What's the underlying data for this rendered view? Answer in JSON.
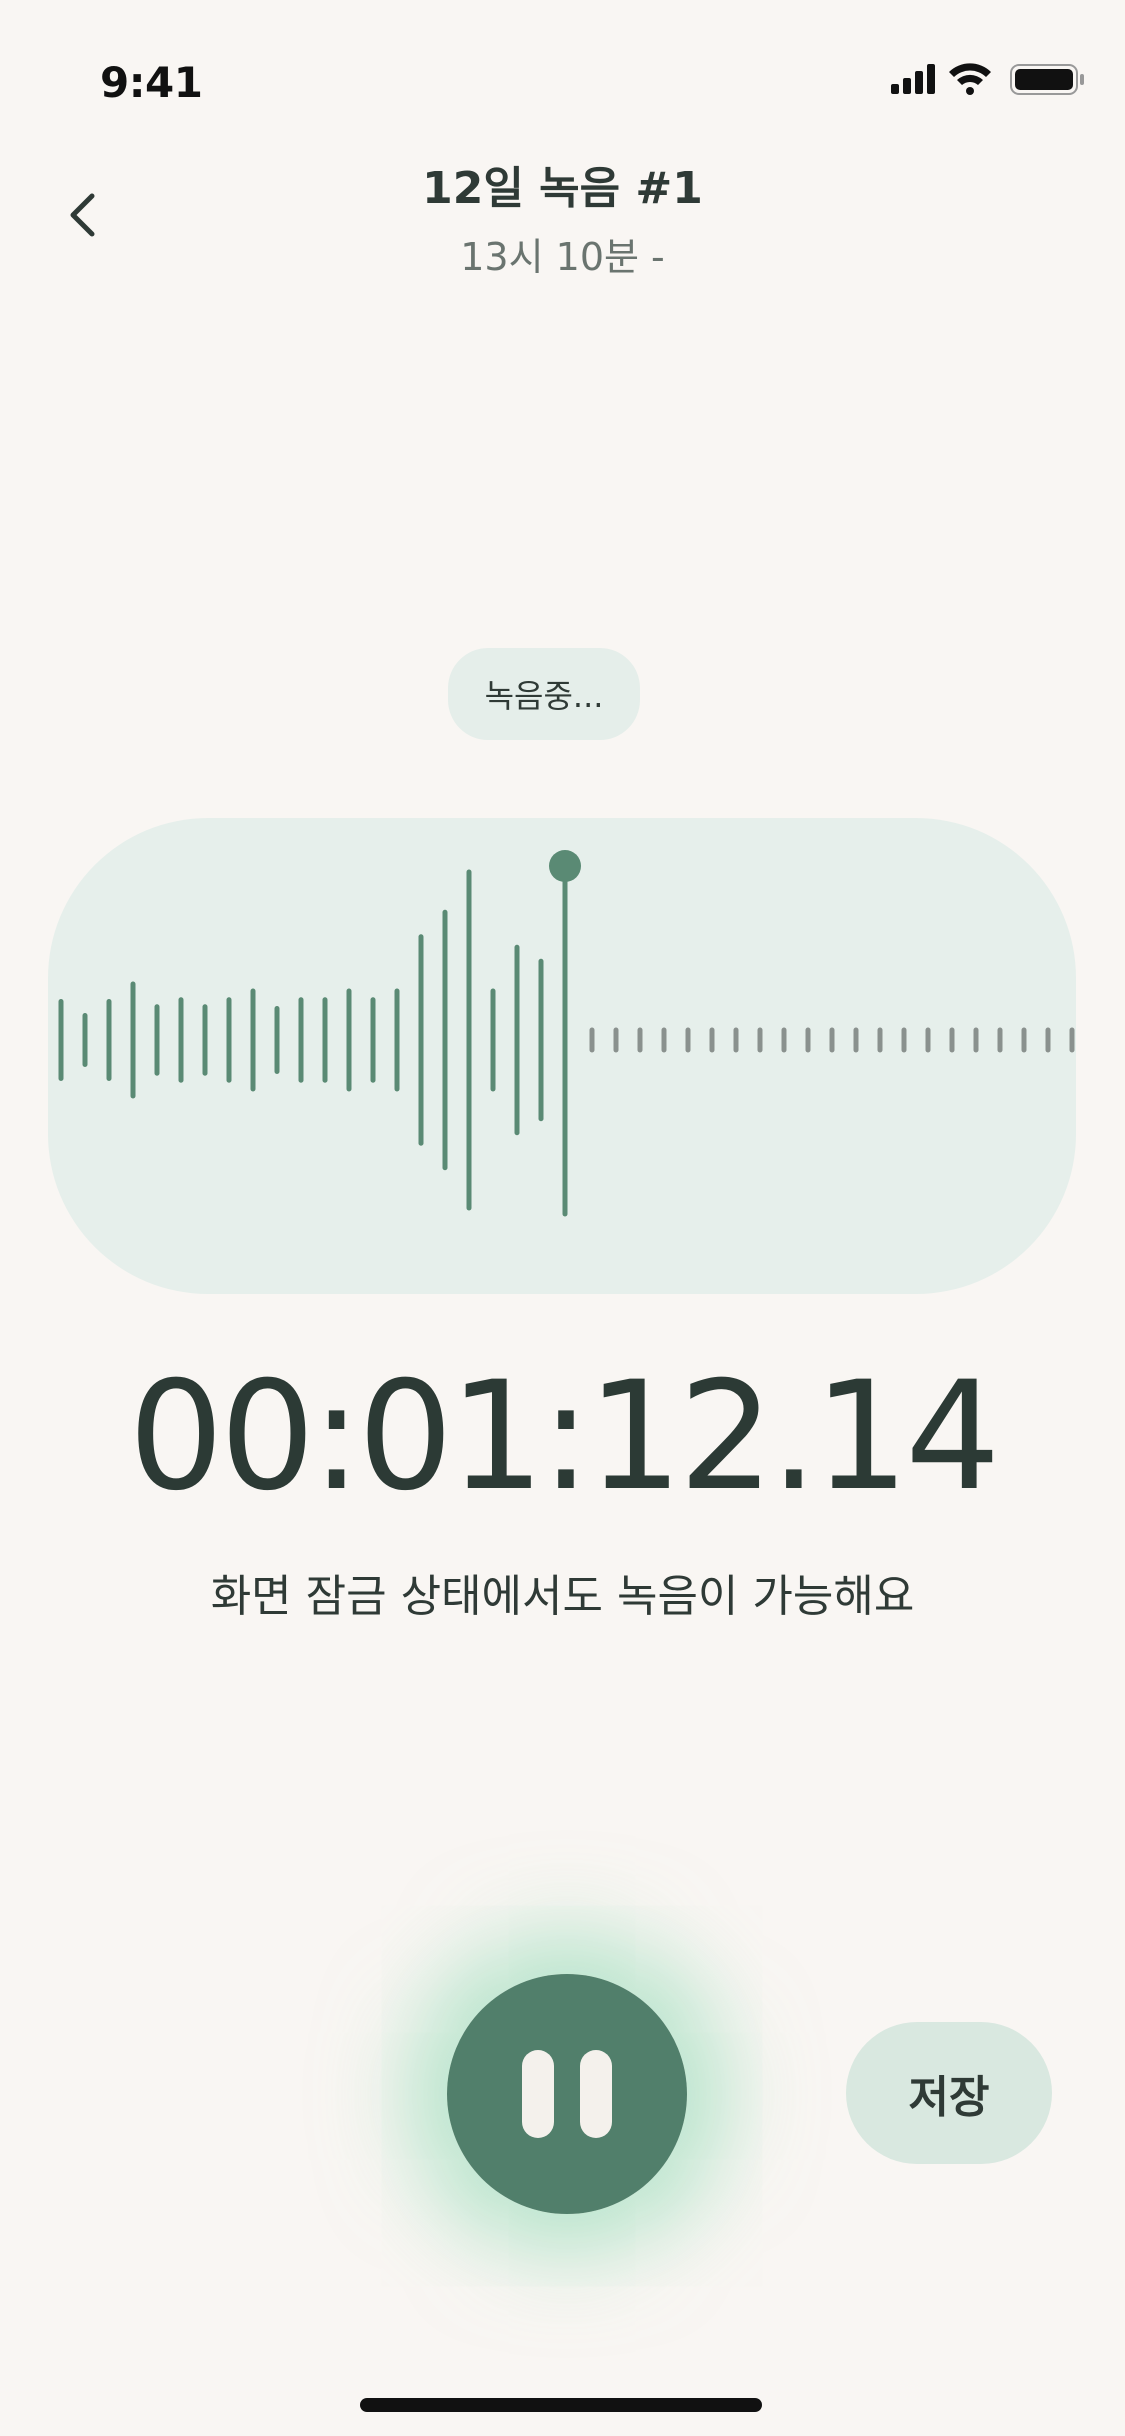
{
  "status_bar": {
    "time": "9:41",
    "signal_icon": "cellular-signal-icon",
    "wifi_icon": "wifi-icon",
    "battery_icon": "battery-icon"
  },
  "header": {
    "back_icon": "chevron-left-icon",
    "title": "12일 녹음 #1",
    "subtitle": "13시 10분 -"
  },
  "recording": {
    "status_label": "녹음중...",
    "elapsed": "00:01:12.14",
    "notice": "화면 잠금 상태에서도 녹음이 가능해요",
    "waveform_recorded_levels": [
      0.22,
      0.14,
      0.22,
      0.32,
      0.19,
      0.23,
      0.19,
      0.23,
      0.28,
      0.18,
      0.23,
      0.23,
      0.28,
      0.23,
      0.28,
      0.59,
      0.73,
      0.96,
      0.28,
      0.53,
      0.45
    ],
    "waveform_pending_ticks": 21
  },
  "controls": {
    "pause_icon": "pause-icon",
    "save_label": "저장"
  },
  "colors": {
    "background": "#f9f6f3",
    "accent": "#517f6b",
    "waveform_recorded": "#5a8a74",
    "waveform_pending": "#8a918e",
    "card": "#e6efeb",
    "save_button": "#d9e8e0",
    "glow": "#7ed6aa"
  }
}
